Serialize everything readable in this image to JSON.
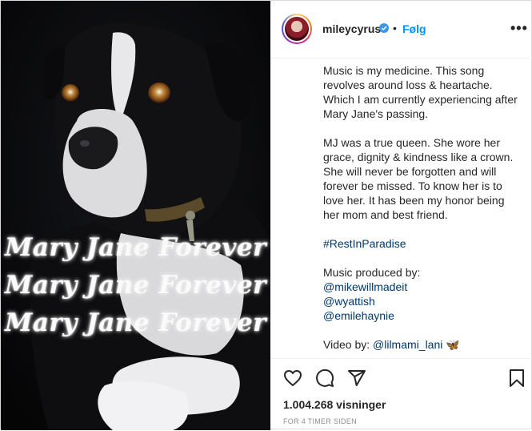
{
  "post": {
    "username": "mileycyrus",
    "follow_label": "Følg",
    "more_label": "•••",
    "dot_separator": "•",
    "verified_icon": "verified-badge-icon",
    "accent_color": "#0095f6",
    "link_color": "#00376b"
  },
  "media": {
    "overlay_lines": [
      "Mary Jane Forever",
      "Mary Jane Forever",
      "Mary Jane Forever"
    ]
  },
  "caption": {
    "paragraph1": "Music is my medicine. This song revolves around loss & heartache. Which I am currently experiencing after Mary Jane's passing.",
    "paragraph2": "MJ was a true queen. She wore her grace, dignity & kindness like a crown. She will never be forgotten and will forever be missed. To know her is to love her. It has been my honor being her mom and best friend.",
    "hashtag": "#RestInParadise",
    "produced_label": "Music produced by:",
    "producers": [
      "@mikewillmadeit",
      "@wyattish",
      "@emilehaynie"
    ],
    "video_label": "Video by: ",
    "video_handle": "@lilmami_lani",
    "video_emoji": "🦋"
  },
  "actions": {
    "like_icon": "heart-icon",
    "comment_icon": "comment-icon",
    "share_icon": "share-icon",
    "save_icon": "bookmark-icon"
  },
  "stats": {
    "views": "1.004.268 visninger",
    "timestamp": "FOR 4 TIMER SIDEN"
  }
}
